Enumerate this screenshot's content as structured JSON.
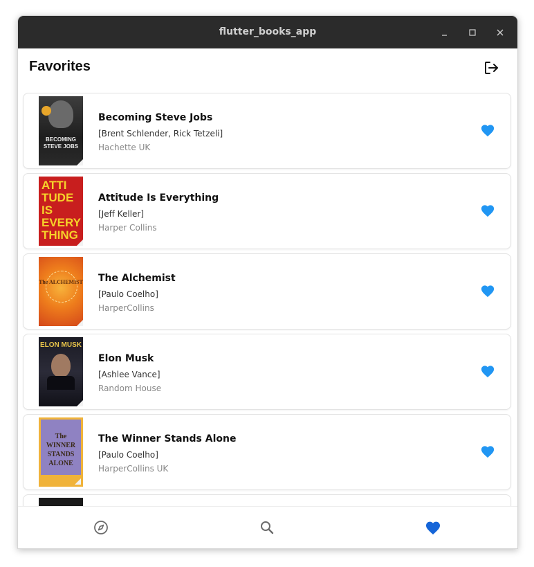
{
  "window": {
    "title": "flutter_books_app"
  },
  "appbar": {
    "title": "Favorites"
  },
  "colors": {
    "accent": "#2196f3",
    "nav_active": "#1565d8",
    "titlebar": "#2b2b2b"
  },
  "books": [
    {
      "title": "Becoming Steve Jobs",
      "authors": "[Brent Schlender, Rick Tetzeli]",
      "publisher": "Hachette UK",
      "cover_text": "BECOMING STEVE JOBS"
    },
    {
      "title": "Attitude Is Everything",
      "authors": "[Jeff Keller]",
      "publisher": "Harper Collins",
      "cover_text": "ATTI TUDE IS EVERY THING"
    },
    {
      "title": "The Alchemist",
      "authors": "[Paulo Coelho]",
      "publisher": "HarperCollins",
      "cover_text": "The ALCHEMIST"
    },
    {
      "title": "Elon Musk",
      "authors": "[Ashlee Vance]",
      "publisher": "Random House",
      "cover_text": "ELON MUSK"
    },
    {
      "title": "The Winner Stands Alone",
      "authors": "[Paulo Coelho]",
      "publisher": "HarperCollins UK",
      "cover_text": "The WINNER STANDS ALONE"
    }
  ],
  "bottom_nav": [
    {
      "icon": "compass-icon",
      "active": false
    },
    {
      "icon": "search-icon",
      "active": false
    },
    {
      "icon": "heart-icon",
      "active": true
    }
  ]
}
